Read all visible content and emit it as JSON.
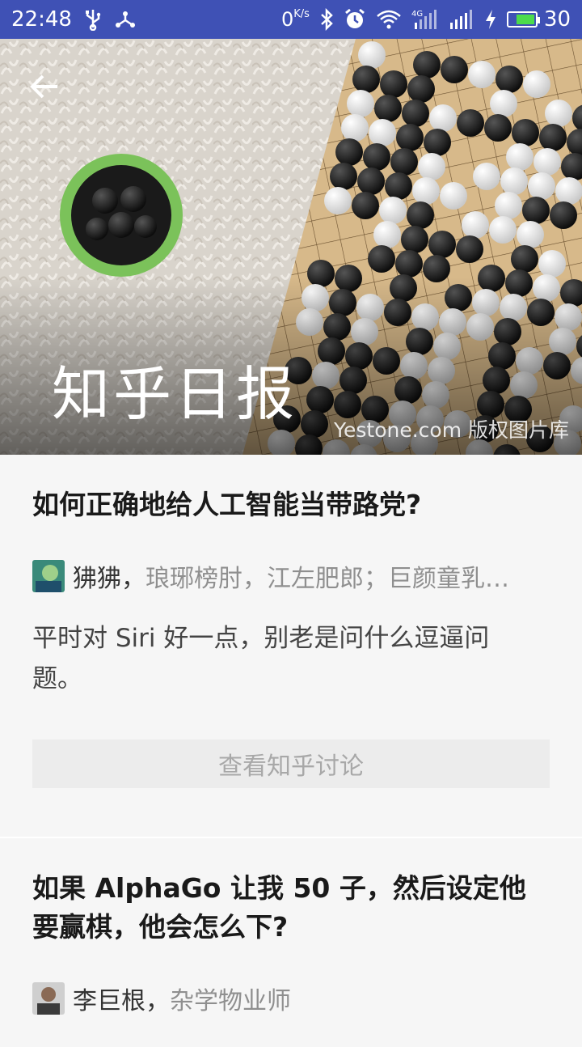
{
  "status_bar": {
    "time": "22:48",
    "net_speed_value": "0",
    "net_speed_unit": "K/s",
    "battery_level": "30",
    "icons": [
      "usb-icon",
      "share-icon",
      "bluetooth-icon",
      "alarm-icon",
      "wifi-icon",
      "signal-4g-icon",
      "signal-icon",
      "charging-icon",
      "battery-icon"
    ]
  },
  "header": {
    "title": "知乎日报",
    "image_credit": "Yestone.com 版权图片库",
    "back_icon": "arrow-back-icon"
  },
  "stories": [
    {
      "title": "如何正确地给人工智能当带路党?",
      "author_name": "狒狒，",
      "author_bio": "琅琊榜肘，江左肥郎；巨颜童乳…",
      "excerpt": "平时对 Siri 好一点，别老是问什么逗逼问题。",
      "button_label": "查看知乎讨论"
    },
    {
      "title": "如果 AlphaGo 让我 50 子，然后设定他要赢棋，他会怎么下?",
      "author_name": "李巨根，",
      "author_bio": "杂学物业师"
    }
  ],
  "colors": {
    "status_bar": "#3f51b5",
    "background": "#f6f6f6",
    "button_bg": "#ececec"
  }
}
